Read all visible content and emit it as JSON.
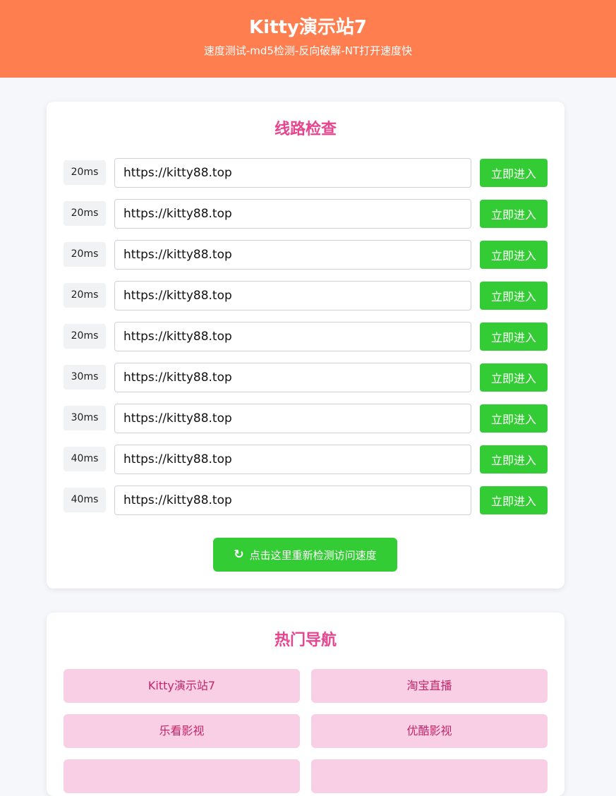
{
  "header": {
    "title": "Kitty演示站7",
    "subtitle": "速度测试-md5检测-反向破解-NT打开速度快"
  },
  "lines": {
    "title": "线路检查",
    "go_label": "立即进入",
    "rows": [
      {
        "ms": "20ms",
        "url": "https://kitty88.top"
      },
      {
        "ms": "20ms",
        "url": "https://kitty88.top"
      },
      {
        "ms": "20ms",
        "url": "https://kitty88.top"
      },
      {
        "ms": "20ms",
        "url": "https://kitty88.top"
      },
      {
        "ms": "20ms",
        "url": "https://kitty88.top"
      },
      {
        "ms": "30ms",
        "url": "https://kitty88.top"
      },
      {
        "ms": "30ms",
        "url": "https://kitty88.top"
      },
      {
        "ms": "40ms",
        "url": "https://kitty88.top"
      },
      {
        "ms": "40ms",
        "url": "https://kitty88.top"
      }
    ],
    "recheck_label": "点击这里重新检测访问速度",
    "recheck_icon": "refresh-icon"
  },
  "nav": {
    "title": "热门导航",
    "items": [
      "Kitty演示站7",
      "淘宝直播",
      "乐看影视",
      "优酷影视",
      "",
      ""
    ]
  },
  "colors": {
    "header_bg": "#ff7e50",
    "accent_pink": "#e8458f",
    "button_green": "#34cc34",
    "nav_bg": "#f9cfe6"
  }
}
